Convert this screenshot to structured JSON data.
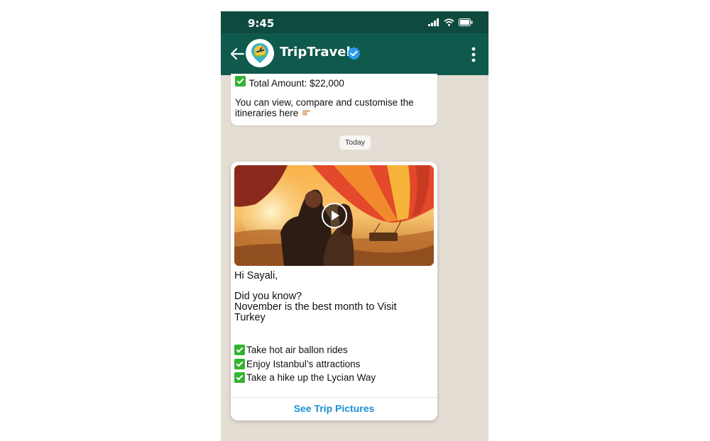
{
  "status_bar": {
    "time": "9:45"
  },
  "header": {
    "title": "TripTravel"
  },
  "previous_message": {
    "total_line": "Total Amount: $22,000",
    "view_line": "You can view, compare and customise the itineraries here"
  },
  "date_chip": "Today",
  "card": {
    "greeting": "Hi Sayali,",
    "did_you_know": "Did you know?",
    "body": "November is the best month to Visit Turkey",
    "items": [
      "Take hot air ballon rides",
      "Enjoy Istanbul’s attractions",
      "Take a hike up the Lycian Way"
    ],
    "cta_label": "See Trip Pictures"
  },
  "colors": {
    "header_bg": "#0f5a4c",
    "status_bg": "#0f4a3f",
    "chat_bg": "#e3ddd4",
    "cta": "#1a8fd1",
    "check": "#34b233",
    "verified": "#2d9bf0"
  },
  "icons": [
    "signal-icon",
    "wifi-icon",
    "battery-icon",
    "back-arrow-icon",
    "verified-badge-icon",
    "more-vertical-icon",
    "play-icon",
    "check-icon",
    "pointing-hand-emoji"
  ]
}
